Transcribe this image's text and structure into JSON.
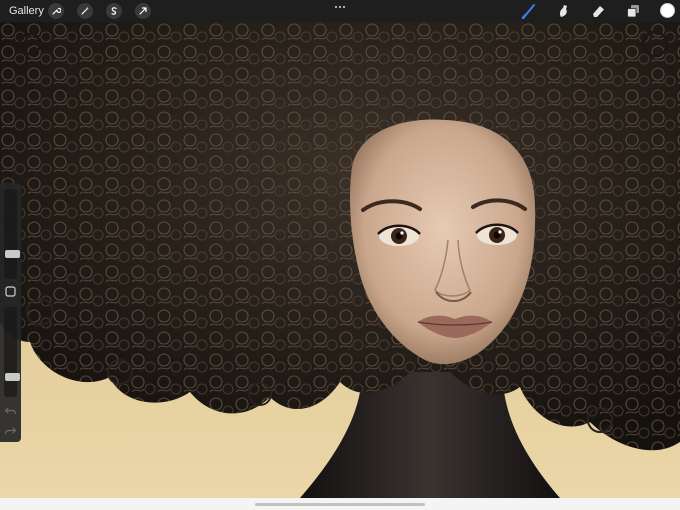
{
  "toolbar": {
    "gallery_label": "Gallery",
    "left_tools": [
      "wrench-icon",
      "magic-wand-icon",
      "selection-icon",
      "transform-icon"
    ],
    "right_tools": [
      "brush-icon",
      "smudge-icon",
      "eraser-icon",
      "layers-icon"
    ],
    "active_tool": "brush-icon",
    "accent_color": "#3d7bff",
    "current_color": "#ffffff"
  },
  "sidebar": {
    "brush_size": 0.26,
    "brush_opacity": 0.2
  },
  "canvas": {
    "background_color": "#e3cb95",
    "hair_color": "#2a231c",
    "skin_color": "#d7b89e"
  }
}
